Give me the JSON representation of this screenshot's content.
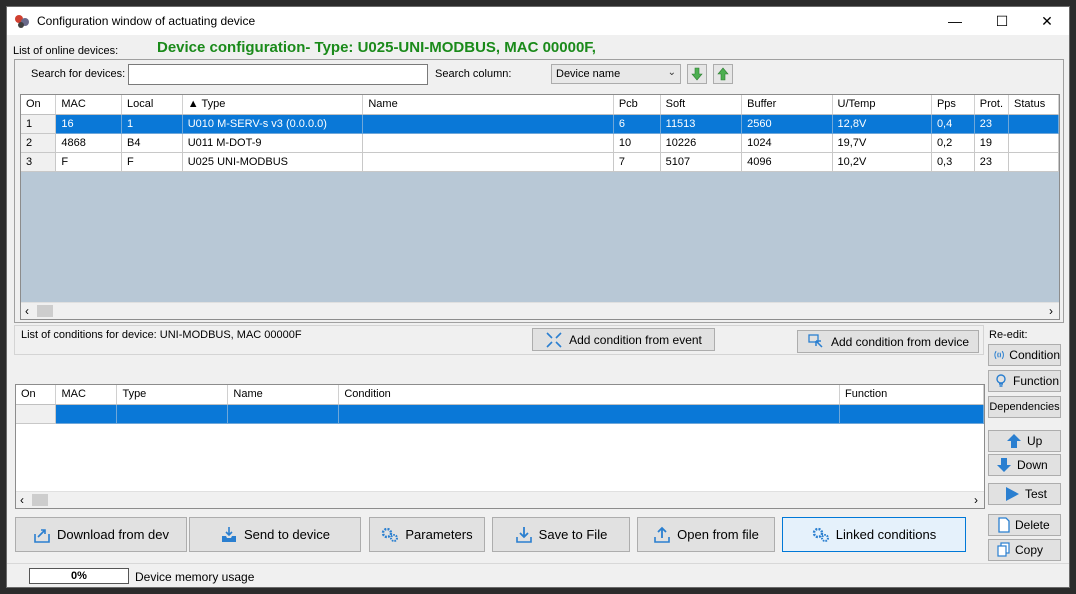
{
  "window": {
    "title": "Configuration window of actuating device",
    "minimize": "—",
    "maximize": "☐",
    "close": "✕"
  },
  "online": {
    "section_label": "List of online devices:",
    "config_title": "Device configuration- Type: U025-UNI-MODBUS, MAC 00000F,",
    "search_label": "Search for devices:",
    "search_value": "",
    "search_column_label": "Search column:",
    "search_column_value": "Device name",
    "columns": [
      "On",
      "MAC",
      "Local",
      "▲ Type",
      "Name",
      "Pcb",
      "Soft",
      "Buffer",
      "U/Temp",
      "Pps",
      "Prot.",
      "Status"
    ],
    "rows": [
      [
        "1",
        "16",
        "1",
        "U010 M-SERV-s v3 (0.0.0.0)",
        "",
        "6",
        "11513",
        "2560",
        "12,8V",
        "0,4",
        "23",
        ""
      ],
      [
        "2",
        "4868",
        "B4",
        "U011 M-DOT-9",
        "",
        "10",
        "10226",
        "1024",
        "19,7V",
        "0,2",
        "19",
        ""
      ],
      [
        "3",
        "F",
        "F",
        "U025 UNI-MODBUS",
        "",
        "7",
        "5107",
        "4096",
        "10,2V",
        "0,3",
        "23",
        ""
      ]
    ]
  },
  "conditions": {
    "section_label": "List of conditions for device: UNI-MODBUS, MAC 00000F",
    "add_from_event": "Add condition from event",
    "add_from_device": "Add condition from device",
    "columns": [
      "On",
      "MAC",
      "Type",
      "Name",
      "Condition",
      "Function"
    ]
  },
  "side": {
    "reedit_label": "Re-edit:",
    "condition": "Condition",
    "function": "Function",
    "dependencies": "Dependencies",
    "up": "Up",
    "down": "Down",
    "test": "Test",
    "delete": "Delete",
    "copy": "Copy"
  },
  "bottom": {
    "download": "Download from dev",
    "send": "Send to device",
    "parameters": "Parameters",
    "save": "Save to File",
    "open": "Open from file",
    "linked": "Linked conditions"
  },
  "status": {
    "progress_text": "0%",
    "progress_value": 0,
    "memory_label": "Device memory usage"
  },
  "colors": {
    "selection": "#0a78d7",
    "title_green": "#1a8a1a",
    "grid_empty": "#b8c8d6"
  }
}
